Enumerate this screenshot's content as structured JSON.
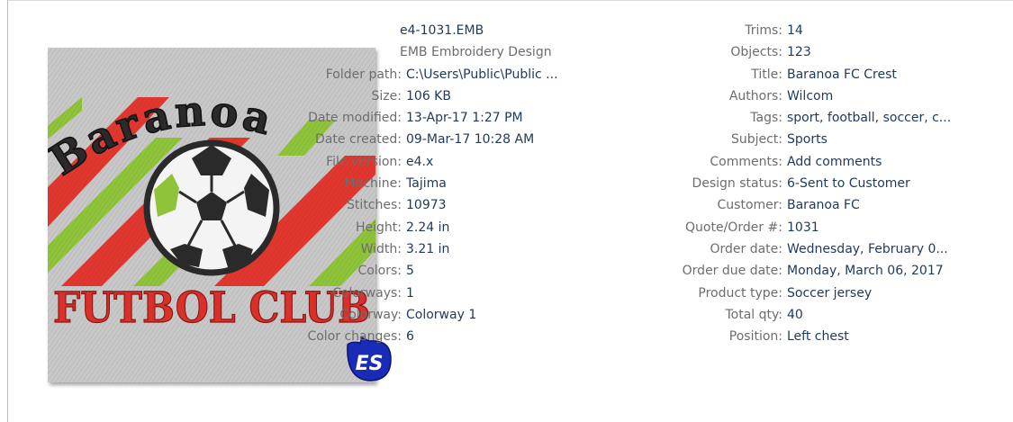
{
  "file": {
    "name": "e4-1031.EMB",
    "type": "EMB Embroidery Design"
  },
  "thumbnail": {
    "arc_text": "Baranoa",
    "bottom_text": "FUTBOL CLUB",
    "badge_text": "ES",
    "colors": {
      "background": "#c8c8c8",
      "red": "#e2372f",
      "green": "#8fc43a",
      "text_red": "#d8302a",
      "arc_text_fill": "#2a2a2a",
      "badge_blue": "#1a2bb8"
    }
  },
  "properties_left": [
    {
      "label": "Folder path:",
      "value": "C:\\Users\\Public\\Public ..."
    },
    {
      "label": "Size:",
      "value": "106 KB"
    },
    {
      "label": "Date modified:",
      "value": "13-Apr-17 1:27 PM"
    },
    {
      "label": "Date created:",
      "value": "09-Mar-17 10:28 AM"
    },
    {
      "label": "File version:",
      "value": "e4.x"
    },
    {
      "label": "Machine:",
      "value": "Tajima"
    },
    {
      "label": "Stitches:",
      "value": "10973"
    },
    {
      "label": "Height:",
      "value": "2.24 in"
    },
    {
      "label": "Width:",
      "value": "3.21 in"
    },
    {
      "label": "Colors:",
      "value": "5"
    },
    {
      "label": "Colorways:",
      "value": "1"
    },
    {
      "label": "Colorway:",
      "value": "Colorway 1"
    },
    {
      "label": "Color changes:",
      "value": "6"
    }
  ],
  "properties_right": [
    {
      "label": "Trims:",
      "value": "14"
    },
    {
      "label": "Objects:",
      "value": "123"
    },
    {
      "label": "Title:",
      "value": "Baranoa FC Crest"
    },
    {
      "label": "Authors:",
      "value": "Wilcom"
    },
    {
      "label": "Tags:",
      "value": "sport, football, soccer, c..."
    },
    {
      "label": "Subject:",
      "value": "Sports"
    },
    {
      "label": "Comments:",
      "value": "Add comments"
    },
    {
      "label": "Design status:",
      "value": "6-Sent to Customer"
    },
    {
      "label": "Customer:",
      "value": "Baranoa FC"
    },
    {
      "label": "Quote/Order #:",
      "value": "1031"
    },
    {
      "label": "Order date:",
      "value": "Wednesday, February 0..."
    },
    {
      "label": "Order due date:",
      "value": "Monday, March 06, 2017"
    },
    {
      "label": "Product type:",
      "value": "Soccer jersey"
    },
    {
      "label": "Total qty:",
      "value": "40"
    },
    {
      "label": "Position:",
      "value": "Left chest"
    }
  ]
}
